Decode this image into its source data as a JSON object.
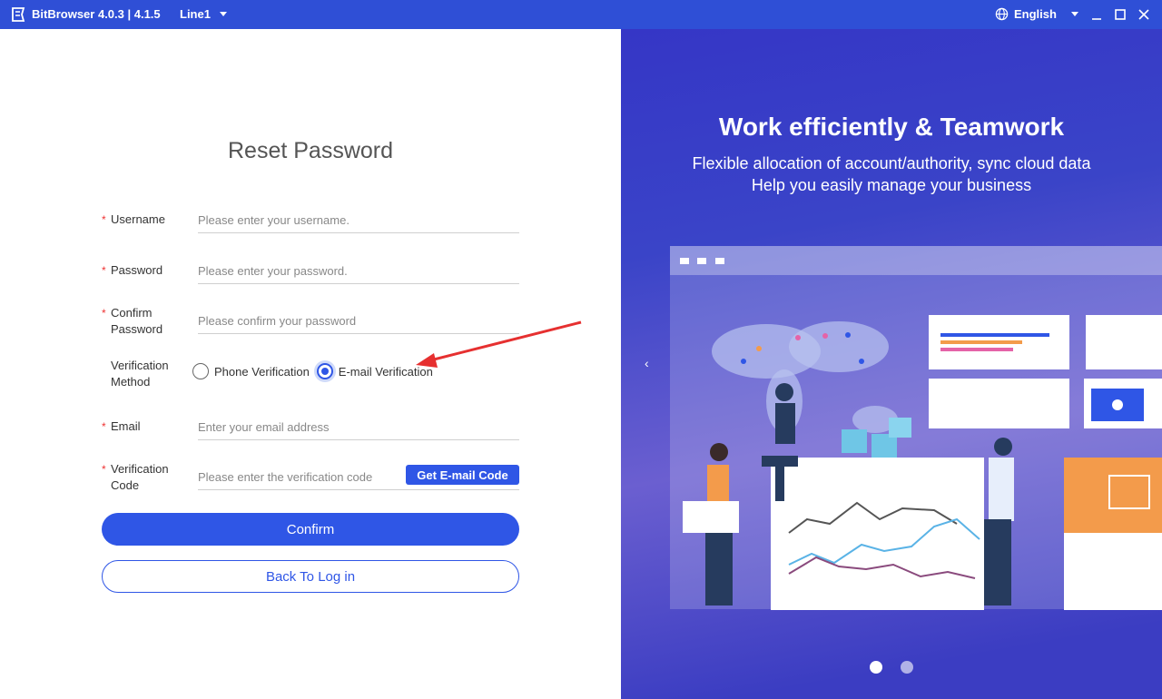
{
  "titlebar": {
    "app_title": "BitBrowser 4.0.3 | 4.1.5",
    "line": "Line1",
    "language": "English"
  },
  "form": {
    "title": "Reset Password",
    "username": {
      "label": "Username",
      "placeholder": "Please enter your username."
    },
    "password": {
      "label": "Password",
      "placeholder": "Please enter your password."
    },
    "confirm": {
      "label_line1": "Confirm",
      "label_line2": "Password",
      "placeholder": "Please confirm your password"
    },
    "verification": {
      "label_line1": "Verification",
      "label_line2": "Method",
      "options": [
        "Phone Verification",
        "E-mail Verification"
      ],
      "selected": "E-mail Verification"
    },
    "email": {
      "label": "Email",
      "placeholder": "Enter your email address"
    },
    "code": {
      "label_line1": "Verification",
      "label_line2": "Code",
      "placeholder": "Please enter the verification code",
      "button": "Get E-mail Code"
    },
    "confirm_button": "Confirm",
    "back_button": "Back To Log in"
  },
  "banner": {
    "title": "Work efficiently & Teamwork",
    "subtitle1": "Flexible allocation of account/authority, sync cloud data",
    "subtitle2": "Help you easily manage your business",
    "slide_count": 2,
    "active_slide": 1
  },
  "colors": {
    "titlebar": "#2f4fd6",
    "accent": "#2f56e6",
    "required": "#e33333",
    "annotation_arrow": "#e63030"
  }
}
